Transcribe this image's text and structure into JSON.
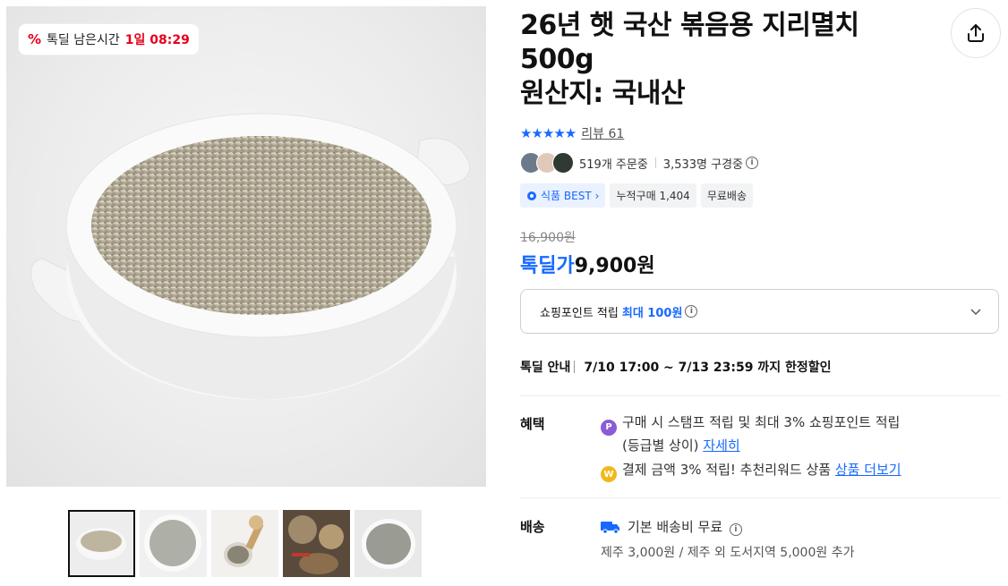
{
  "deal_badge": {
    "label": "톡딜 남은시간",
    "time": "1일 08:29"
  },
  "product": {
    "title_lines": [
      "26년 햇 국산 볶음용 지리멸치",
      "500g",
      "원산지: 국내산"
    ],
    "stars": "★★★★★",
    "review_label": "리뷰 61",
    "orders": "519개 주문중",
    "viewers": "3,533명 구경중"
  },
  "tags": [
    "식품 BEST",
    "누적구매 1,404",
    "무료배송"
  ],
  "price": {
    "original": "16,900원",
    "sale_label": "톡딜가",
    "sale_value": "9,900원"
  },
  "points": {
    "label": "쇼핑포인트 적립",
    "highlight": "최대 100원"
  },
  "deal_info": {
    "label": "톡딜 안내",
    "period": "7/10 17:00 ~ 7/13 23:59 까지 한정할인"
  },
  "benefits": {
    "label": "혜택",
    "line1": "구매 시 스탬프 적립 및 최대 3% 쇼핑포인트 적립",
    "line1_sub": "(등급별 상이)",
    "line1_link": "자세히",
    "line2": "결제 금액 3% 적립! 추천리워드 상품",
    "line2_link": "상품 더보기"
  },
  "shipping": {
    "label": "배송",
    "line1": "기본 배송비 무료",
    "line2": "제주 3,000원 / 제주 외 도서지역 5,000원 추가"
  },
  "colors": {
    "accent": "#1769ff",
    "deal_red": "#e6001a"
  },
  "icons": [
    "share-icon",
    "percent-icon",
    "info-icon",
    "chevron-down-icon",
    "truck-icon",
    "point-p-icon",
    "reward-coin-icon",
    "gear-icon"
  ]
}
